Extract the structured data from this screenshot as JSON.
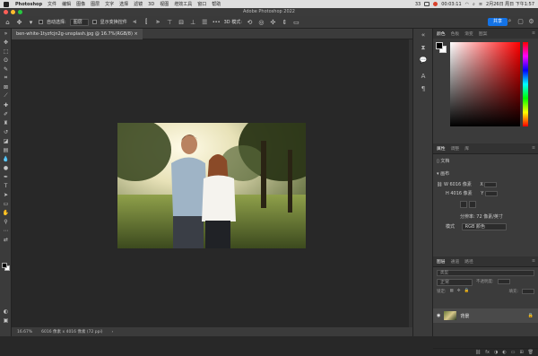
{
  "menubar": {
    "app": "Photoshop",
    "items": [
      "文件",
      "编辑",
      "图像",
      "图层",
      "文字",
      "选择",
      "滤镜",
      "3D",
      "视图",
      "增效工具",
      "窗口",
      "帮助"
    ],
    "battery_count": "33",
    "timer": "00:03:11",
    "clock": "2月26日 周日 下午1:57"
  },
  "window": {
    "title": "Adobe Photoshop 2022"
  },
  "options": {
    "auto_select_label": "自动选择:",
    "auto_select_value": "图层",
    "transform_label": "显示变换控件",
    "more": "•••",
    "mode3d": "3D 模式:",
    "share": "共享"
  },
  "document": {
    "tab": "ben-white-1tyzfcjn2g-unsplash.jpg @ 16.7%(RGB/8)",
    "zoom": "16.67%",
    "size": "6016 像素 x 4016 像素 (72 ppi)"
  },
  "color_panel": {
    "tabs": [
      "颜色",
      "色板",
      "渐变",
      "图案"
    ]
  },
  "properties": {
    "tabs": [
      "属性",
      "调整",
      "库"
    ],
    "doc_label": "文档",
    "canvas_label": "画布",
    "w_label": "W",
    "w_value": "6016 像素",
    "h_label": "H",
    "h_value": "4016 像素",
    "x_label": "X",
    "y_label": "Y",
    "resolution": "分辨率: 72 像素/英寸",
    "mode_label": "模式",
    "mode_value": "RGB 颜色"
  },
  "layers": {
    "tabs": [
      "图层",
      "通道",
      "路径"
    ],
    "kind": "类型",
    "blend": "正常",
    "opacity_label": "不透明度:",
    "lock_label": "锁定:",
    "fill_label": "填充:",
    "layer_name": "背景"
  }
}
